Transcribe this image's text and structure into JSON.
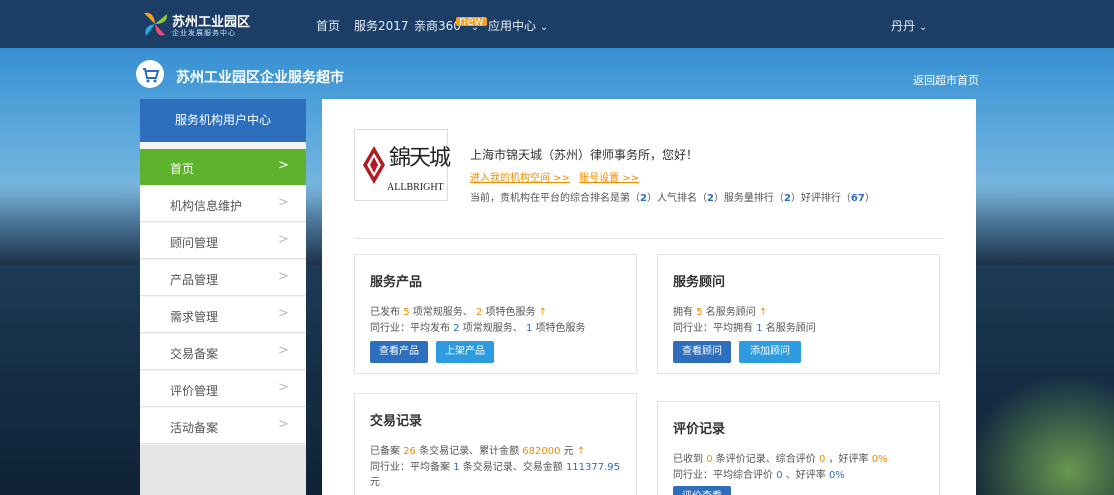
{
  "header": {
    "logo_title": "苏州工业园区",
    "logo_subtitle": "企业发展服务中心",
    "nav": [
      {
        "label": "首页"
      },
      {
        "label": "服务2017"
      },
      {
        "label": "亲商360°",
        "badge": "new"
      },
      {
        "label": "应用中心"
      }
    ],
    "user_name": "丹丹"
  },
  "banner": {
    "title": "苏州工业园区企业服务超市",
    "back_link": "返回超市首页"
  },
  "sidebar": {
    "heading": "服务机构用户中心",
    "items": [
      {
        "label": "首页",
        "active": true
      },
      {
        "label": "机构信息维护"
      },
      {
        "label": "顾问管理"
      },
      {
        "label": "产品管理"
      },
      {
        "label": "需求管理"
      },
      {
        "label": "交易备案"
      },
      {
        "label": "评价管理"
      },
      {
        "label": "活动备案"
      }
    ]
  },
  "profile": {
    "logo_cn": "錦天城",
    "logo_en": "ALLBRIGHT",
    "greeting": "上海市锦天城（苏州）律师事务所，您好！",
    "link_space": "进入我的机构空间 >>",
    "link_settings": "账号设置 >>",
    "rank_prefix": "当前，贵机构在平台的综合排名是第（",
    "rank_overall": "2",
    "rank_mid1": "）人气排名（",
    "rank_popularity": "2",
    "rank_mid2": "）服务量排行（",
    "rank_service": "2",
    "rank_mid3": "）好评排行（",
    "rank_rating": "67",
    "rank_suffix": "）"
  },
  "cards": {
    "products": {
      "title": "服务产品",
      "l1_a": "已发布",
      "l1_n1": "5",
      "l1_b": "项常规服务、",
      "l1_n2": "2",
      "l1_c": "项特色服务",
      "l2_a": "同行业：平均发布",
      "l2_n1": "2",
      "l2_b": "项常规服务、",
      "l2_n2": "1",
      "l2_c": "项特色服务",
      "btn1": "查看产品",
      "btn2": "上架产品"
    },
    "advisors": {
      "title": "服务顾问",
      "l1_a": "拥有",
      "l1_n1": "5",
      "l1_b": "名服务顾问",
      "l2_a": "同行业：平均拥有",
      "l2_n1": "1",
      "l2_b": "名服务顾问",
      "btn1": "查看顾问",
      "btn2": "添加顾问"
    },
    "trades": {
      "title": "交易记录",
      "l1_a": "已备案",
      "l1_n1": "26",
      "l1_b": "条交易记录、累计金额",
      "l1_n2": "682000",
      "l1_c": "元",
      "l2_a": "同行业：平均备案",
      "l2_n1": "1",
      "l2_b": "条交易记录、交易金额",
      "l2_n2": "111377.95",
      "l3": "元"
    },
    "reviews": {
      "title": "评价记录",
      "l1_a": "已收到",
      "l1_n1": "0",
      "l1_b": "条评价记录、综合评价",
      "l1_n2": "0",
      "l1_c": "，好评率",
      "l1_n3": "0%",
      "l2_a": "同行业：平均综合评价",
      "l2_n1": "0",
      "l2_b": "、好评率",
      "l2_n2": "0%",
      "btn1": "评价查看"
    }
  },
  "colors": {
    "topbar": "#1b3d66",
    "primary": "#2d6fbd",
    "active_green": "#5cb32b",
    "highlight_orange": "#f08c00"
  },
  "icons": {
    "logo": "pinwheel-logo-icon",
    "cart": "shopping-cart-icon",
    "chevron": "chevron-down-icon",
    "arrow": "chevron-right-icon",
    "up": "arrow-up-icon"
  }
}
